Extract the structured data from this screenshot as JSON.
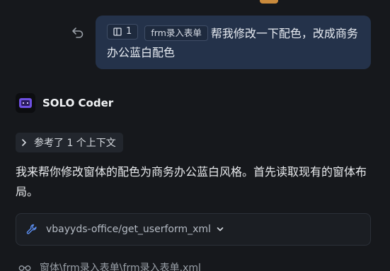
{
  "user_message": {
    "chip_count": "1",
    "chip_file": "frm录入表单",
    "text": "帮我修改一下配色，改成商务办公蓝白配色"
  },
  "agent": {
    "name": "SOLO Coder"
  },
  "context": {
    "label": "参考了 1 个上下文"
  },
  "reply": {
    "text": "我来帮你修改窗体的配色为商务办公蓝白风格。首先读取现有的窗体布局。"
  },
  "tool_call": {
    "label": "vbayyds-office/get_userform_xml"
  },
  "file_ref": {
    "path": "窗体\\frm录入表单\\frm录入表单.xml"
  },
  "icons": {
    "undo": "undo-icon",
    "panel": "panel-icon",
    "agent": "robot-icon",
    "chevron_right": "chevron-right-icon",
    "tool": "wrench-icon",
    "chevron_down": "chevron-down-icon",
    "glasses": "glasses-icon"
  },
  "colors": {
    "background": "#16181c",
    "bubble": "#24324a",
    "accent": "#c98a3c",
    "tool_icon": "#5b8def",
    "agent_icon": "#8b6cf6"
  }
}
